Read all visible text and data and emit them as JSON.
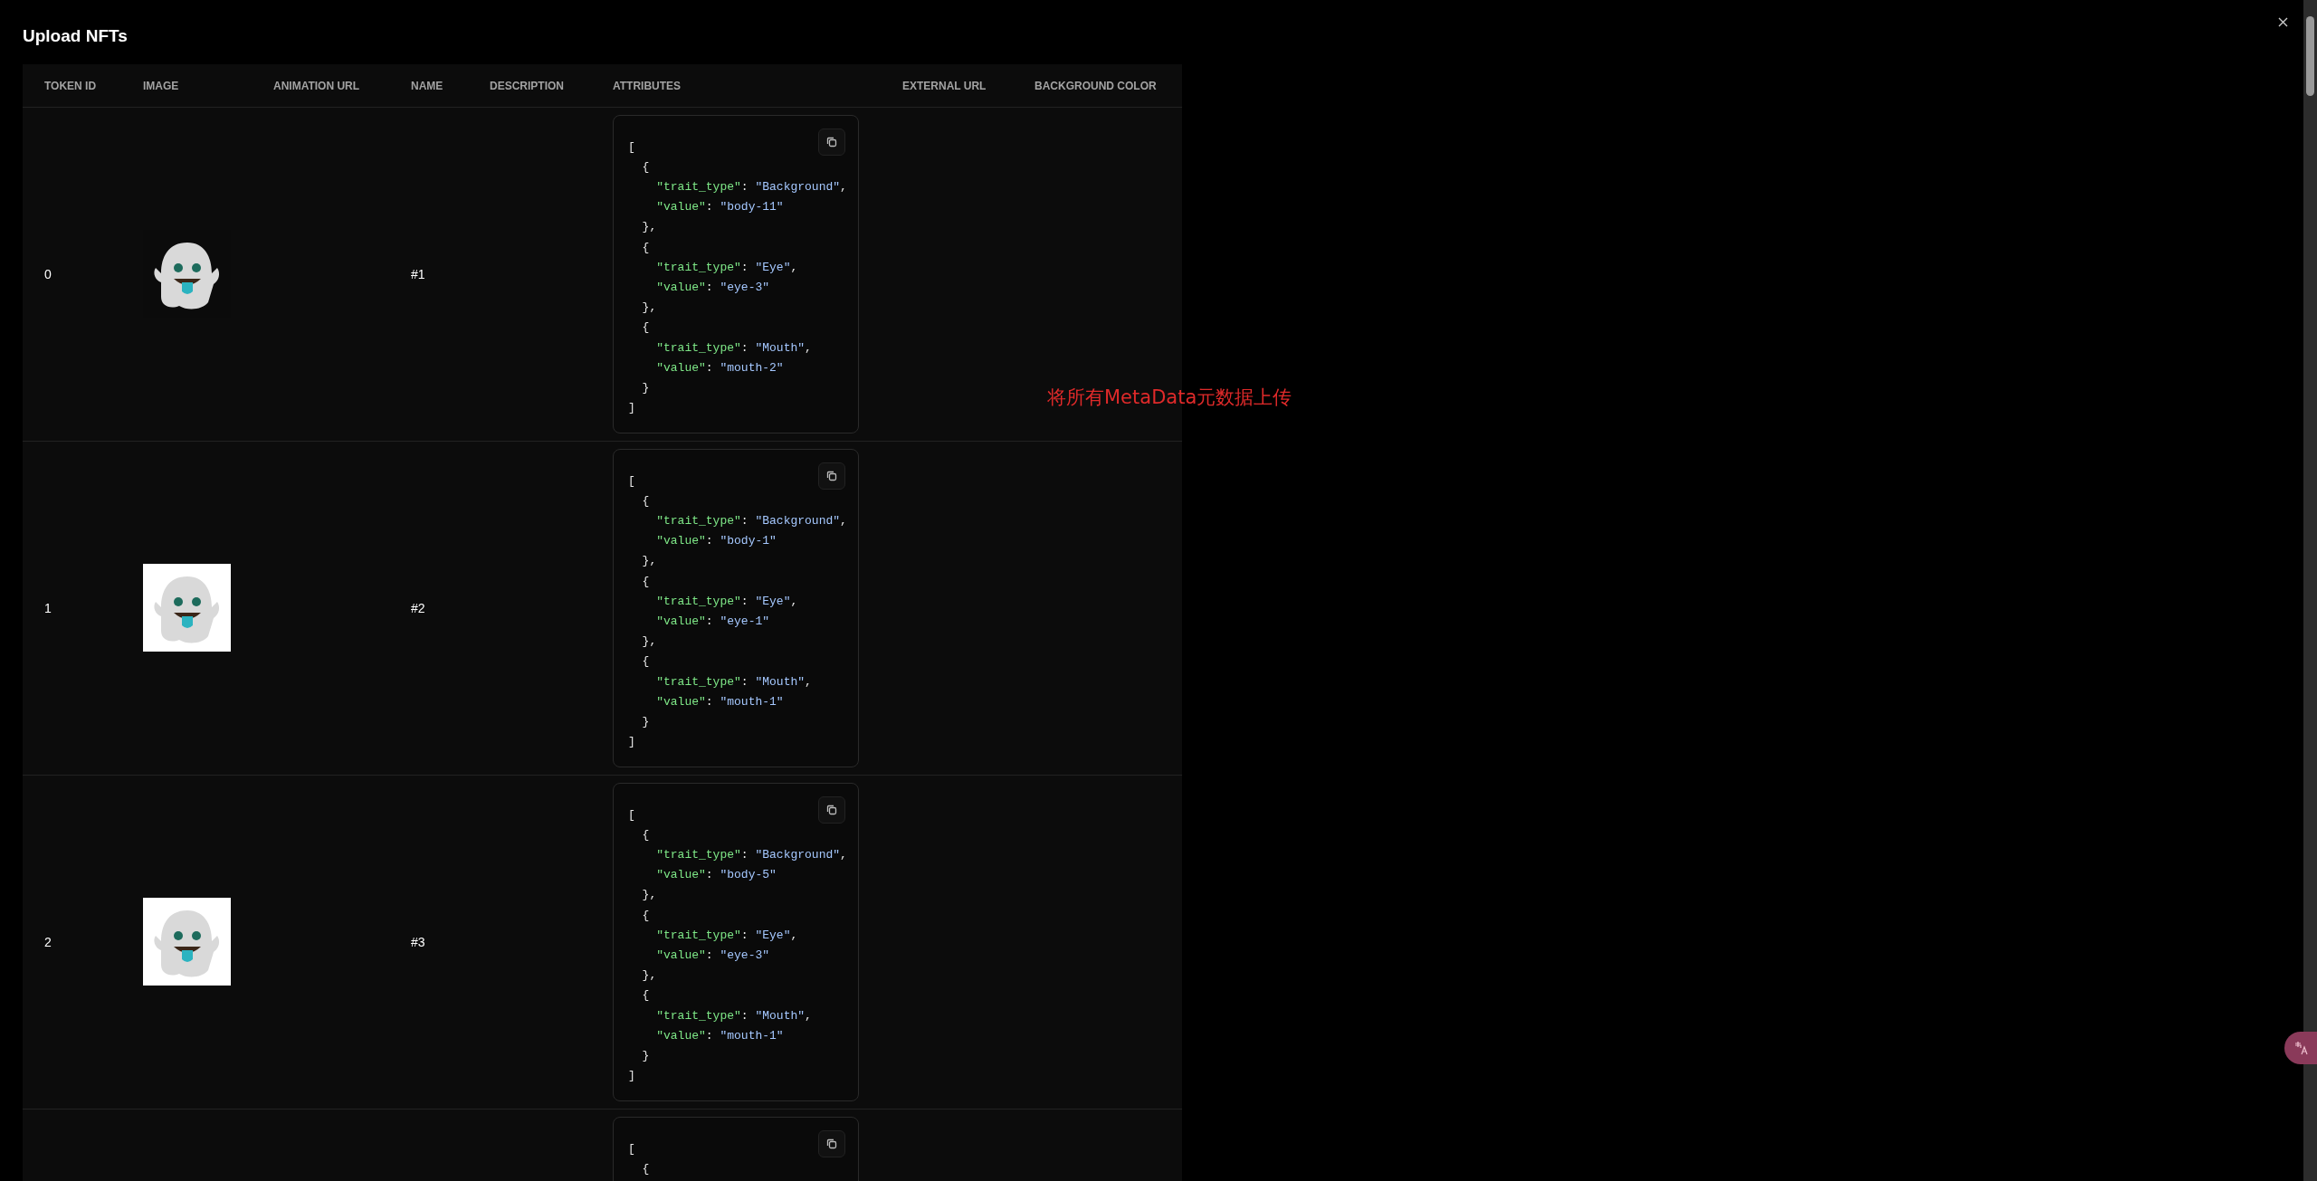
{
  "dialog": {
    "title": "Upload NFTs"
  },
  "table": {
    "columns": [
      "TOKEN ID",
      "IMAGE",
      "ANIMATION URL",
      "NAME",
      "DESCRIPTION",
      "ATTRIBUTES",
      "EXTERNAL URL",
      "BACKGROUND COLOR"
    ],
    "rows": [
      {
        "token_id": "0",
        "name": "#1",
        "image": {
          "kind": "dark"
        },
        "attributes": [
          [
            {
              "kind": "punct",
              "text": "["
            }
          ],
          [
            {
              "kind": "punct",
              "text": "  {"
            }
          ],
          [
            {
              "kind": "key",
              "text": "    \"trait_type\""
            },
            {
              "kind": "punct",
              "text": ": "
            },
            {
              "kind": "string",
              "text": "\"Background\""
            },
            {
              "kind": "punct",
              "text": ","
            }
          ],
          [
            {
              "kind": "key",
              "text": "    \"value\""
            },
            {
              "kind": "punct",
              "text": ": "
            },
            {
              "kind": "string",
              "text": "\"body-11\""
            }
          ],
          [
            {
              "kind": "punct",
              "text": "  },"
            }
          ],
          [
            {
              "kind": "punct",
              "text": "  {"
            }
          ],
          [
            {
              "kind": "key",
              "text": "    \"trait_type\""
            },
            {
              "kind": "punct",
              "text": ": "
            },
            {
              "kind": "string",
              "text": "\"Eye\""
            },
            {
              "kind": "punct",
              "text": ","
            }
          ],
          [
            {
              "kind": "key",
              "text": "    \"value\""
            },
            {
              "kind": "punct",
              "text": ": "
            },
            {
              "kind": "string",
              "text": "\"eye-3\""
            }
          ],
          [
            {
              "kind": "punct",
              "text": "  },"
            }
          ],
          [
            {
              "kind": "punct",
              "text": "  {"
            }
          ],
          [
            {
              "kind": "key",
              "text": "    \"trait_type\""
            },
            {
              "kind": "punct",
              "text": ": "
            },
            {
              "kind": "string",
              "text": "\"Mouth\""
            },
            {
              "kind": "punct",
              "text": ","
            }
          ],
          [
            {
              "kind": "key",
              "text": "    \"value\""
            },
            {
              "kind": "punct",
              "text": ": "
            },
            {
              "kind": "string",
              "text": "\"mouth-2\""
            }
          ],
          [
            {
              "kind": "punct",
              "text": "  }"
            }
          ],
          [
            {
              "kind": "punct",
              "text": "]"
            }
          ]
        ]
      },
      {
        "token_id": "1",
        "name": "#2",
        "image": {
          "kind": "light"
        },
        "attributes": [
          [
            {
              "kind": "punct",
              "text": "["
            }
          ],
          [
            {
              "kind": "punct",
              "text": "  {"
            }
          ],
          [
            {
              "kind": "key",
              "text": "    \"trait_type\""
            },
            {
              "kind": "punct",
              "text": ": "
            },
            {
              "kind": "string",
              "text": "\"Background\""
            },
            {
              "kind": "punct",
              "text": ","
            }
          ],
          [
            {
              "kind": "key",
              "text": "    \"value\""
            },
            {
              "kind": "punct",
              "text": ": "
            },
            {
              "kind": "string",
              "text": "\"body-1\""
            }
          ],
          [
            {
              "kind": "punct",
              "text": "  },"
            }
          ],
          [
            {
              "kind": "punct",
              "text": "  {"
            }
          ],
          [
            {
              "kind": "key",
              "text": "    \"trait_type\""
            },
            {
              "kind": "punct",
              "text": ": "
            },
            {
              "kind": "string",
              "text": "\"Eye\""
            },
            {
              "kind": "punct",
              "text": ","
            }
          ],
          [
            {
              "kind": "key",
              "text": "    \"value\""
            },
            {
              "kind": "punct",
              "text": ": "
            },
            {
              "kind": "string",
              "text": "\"eye-1\""
            }
          ],
          [
            {
              "kind": "punct",
              "text": "  },"
            }
          ],
          [
            {
              "kind": "punct",
              "text": "  {"
            }
          ],
          [
            {
              "kind": "key",
              "text": "    \"trait_type\""
            },
            {
              "kind": "punct",
              "text": ": "
            },
            {
              "kind": "string",
              "text": "\"Mouth\""
            },
            {
              "kind": "punct",
              "text": ","
            }
          ],
          [
            {
              "kind": "key",
              "text": "    \"value\""
            },
            {
              "kind": "punct",
              "text": ": "
            },
            {
              "kind": "string",
              "text": "\"mouth-1\""
            }
          ],
          [
            {
              "kind": "punct",
              "text": "  }"
            }
          ],
          [
            {
              "kind": "punct",
              "text": "]"
            }
          ]
        ]
      },
      {
        "token_id": "2",
        "name": "#3",
        "image": {
          "kind": "light"
        },
        "attributes": [
          [
            {
              "kind": "punct",
              "text": "["
            }
          ],
          [
            {
              "kind": "punct",
              "text": "  {"
            }
          ],
          [
            {
              "kind": "key",
              "text": "    \"trait_type\""
            },
            {
              "kind": "punct",
              "text": ": "
            },
            {
              "kind": "string",
              "text": "\"Background\""
            },
            {
              "kind": "punct",
              "text": ","
            }
          ],
          [
            {
              "kind": "key",
              "text": "    \"value\""
            },
            {
              "kind": "punct",
              "text": ": "
            },
            {
              "kind": "string",
              "text": "\"body-5\""
            }
          ],
          [
            {
              "kind": "punct",
              "text": "  },"
            }
          ],
          [
            {
              "kind": "punct",
              "text": "  {"
            }
          ],
          [
            {
              "kind": "key",
              "text": "    \"trait_type\""
            },
            {
              "kind": "punct",
              "text": ": "
            },
            {
              "kind": "string",
              "text": "\"Eye\""
            },
            {
              "kind": "punct",
              "text": ","
            }
          ],
          [
            {
              "kind": "key",
              "text": "    \"value\""
            },
            {
              "kind": "punct",
              "text": ": "
            },
            {
              "kind": "string",
              "text": "\"eye-3\""
            }
          ],
          [
            {
              "kind": "punct",
              "text": "  },"
            }
          ],
          [
            {
              "kind": "punct",
              "text": "  {"
            }
          ],
          [
            {
              "kind": "key",
              "text": "    \"trait_type\""
            },
            {
              "kind": "punct",
              "text": ": "
            },
            {
              "kind": "string",
              "text": "\"Mouth\""
            },
            {
              "kind": "punct",
              "text": ","
            }
          ],
          [
            {
              "kind": "key",
              "text": "    \"value\""
            },
            {
              "kind": "punct",
              "text": ": "
            },
            {
              "kind": "string",
              "text": "\"mouth-1\""
            }
          ],
          [
            {
              "kind": "punct",
              "text": "  }"
            }
          ],
          [
            {
              "kind": "punct",
              "text": "]"
            }
          ]
        ]
      },
      {
        "attributes": [
          [
            {
              "kind": "punct",
              "text": "["
            }
          ],
          [
            {
              "kind": "punct",
              "text": "  {"
            }
          ]
        ]
      }
    ]
  },
  "annotation": "将所有MetaData元数据上传"
}
